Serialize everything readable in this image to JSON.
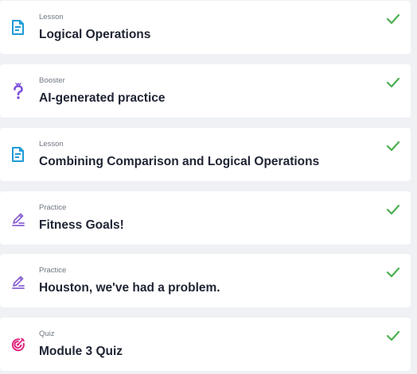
{
  "colors": {
    "page_background": "#eff1f4",
    "card_background": "#ffffff",
    "lesson_icon": "#1e9bd7",
    "booster_icon": "#7b4fd8",
    "practice_icon": "#8a63d2",
    "quiz_icon": "#e0257d",
    "check": "#4caf50",
    "title_text": "#1f2433",
    "type_text": "#6f7680"
  },
  "items": [
    {
      "type": "Lesson",
      "title": "Logical Operations",
      "icon": "lesson-icon",
      "status": "completed"
    },
    {
      "type": "Booster",
      "title": "AI-generated practice",
      "icon": "booster-question-icon",
      "status": "completed"
    },
    {
      "type": "Lesson",
      "title": "Combining Comparison and Logical Operations",
      "icon": "lesson-icon",
      "status": "completed"
    },
    {
      "type": "Practice",
      "title": "Fitness Goals!",
      "icon": "practice-pencil-icon",
      "status": "completed"
    },
    {
      "type": "Practice",
      "title": "Houston, we've had a problem.",
      "icon": "practice-pencil-icon",
      "status": "completed"
    },
    {
      "type": "Quiz",
      "title": "Module 3 Quiz",
      "icon": "quiz-target-icon",
      "status": "completed"
    }
  ]
}
